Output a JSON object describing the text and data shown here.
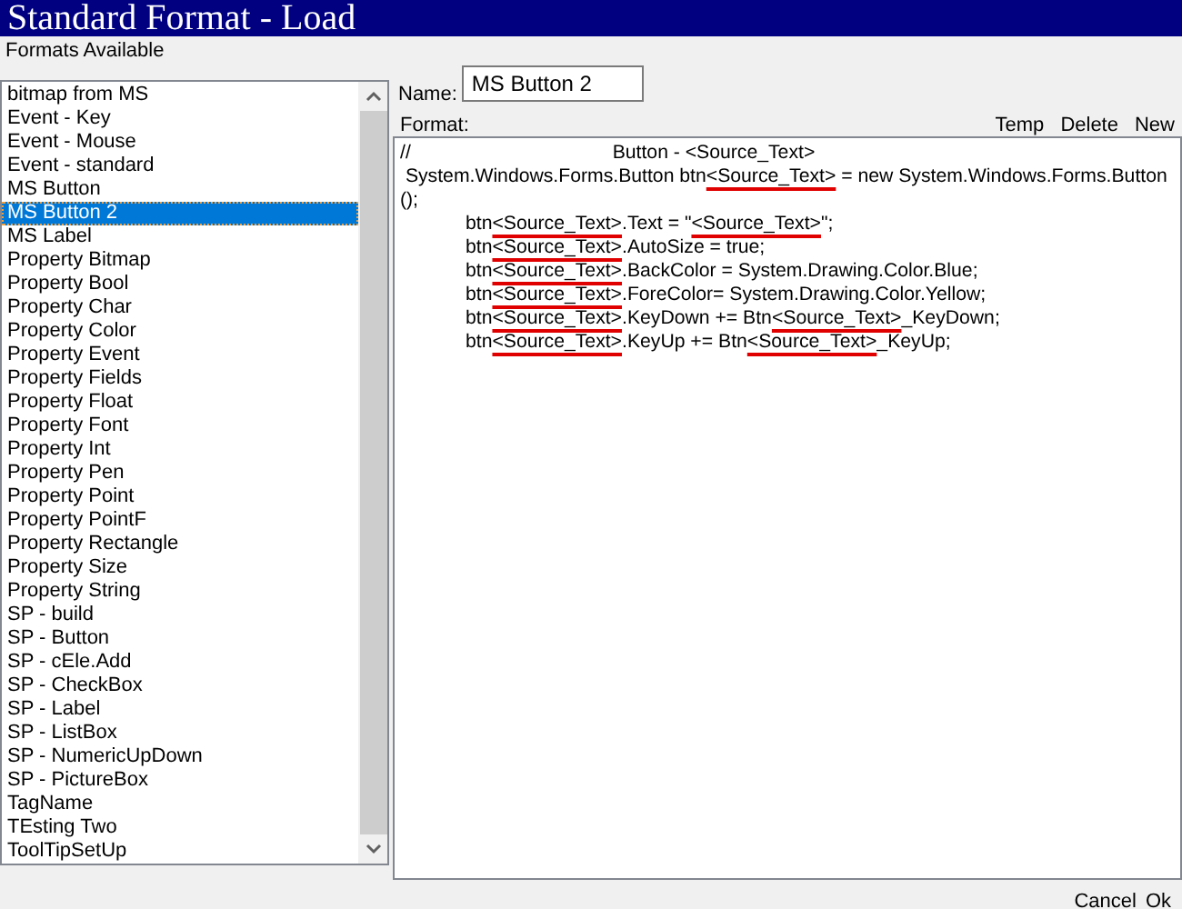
{
  "window": {
    "title": "Standard Format - Load"
  },
  "formats_label": "Formats Available",
  "formats": [
    {
      "label": "bitmap from MS",
      "selected": false
    },
    {
      "label": "Event - Key",
      "selected": false
    },
    {
      "label": "Event - Mouse",
      "selected": false
    },
    {
      "label": "Event - standard",
      "selected": false
    },
    {
      "label": "MS Button",
      "selected": false
    },
    {
      "label": "MS Button 2",
      "selected": true
    },
    {
      "label": "MS Label",
      "selected": false
    },
    {
      "label": "Property Bitmap",
      "selected": false
    },
    {
      "label": "Property Bool",
      "selected": false
    },
    {
      "label": "Property Char",
      "selected": false
    },
    {
      "label": "Property Color",
      "selected": false
    },
    {
      "label": "Property Event",
      "selected": false
    },
    {
      "label": "Property Fields",
      "selected": false
    },
    {
      "label": "Property Float",
      "selected": false
    },
    {
      "label": "Property Font",
      "selected": false
    },
    {
      "label": "Property Int",
      "selected": false
    },
    {
      "label": "Property Pen",
      "selected": false
    },
    {
      "label": "Property Point",
      "selected": false
    },
    {
      "label": "Property PointF",
      "selected": false
    },
    {
      "label": "Property Rectangle",
      "selected": false
    },
    {
      "label": "Property Size",
      "selected": false
    },
    {
      "label": "Property String",
      "selected": false
    },
    {
      "label": "SP - build",
      "selected": false
    },
    {
      "label": "SP - Button",
      "selected": false
    },
    {
      "label": "SP - cEle.Add",
      "selected": false
    },
    {
      "label": "SP - CheckBox",
      "selected": false
    },
    {
      "label": "SP - Label",
      "selected": false
    },
    {
      "label": "SP - ListBox",
      "selected": false
    },
    {
      "label": "SP - NumericUpDown",
      "selected": false
    },
    {
      "label": "SP - PictureBox",
      "selected": false
    },
    {
      "label": "TagName",
      "selected": false
    },
    {
      "label": "TEsting Two",
      "selected": false
    },
    {
      "label": "ToolTipSetUp",
      "selected": false
    }
  ],
  "name_field": {
    "label": "Name:",
    "value": "MS Button 2"
  },
  "format_label": "Format:",
  "format_actions": [
    "Temp",
    "Delete",
    "New"
  ],
  "format_lines": [
    {
      "segments": [
        {
          "text": "//\t\t\t   Button - <Source_Text>",
          "marked": false
        }
      ]
    },
    {
      "segments": [
        {
          "text": " System.Windows.Forms.Button btn",
          "marked": false
        },
        {
          "text": "<Source_Text>",
          "marked": true
        },
        {
          "text": " = new System.Windows.Forms.Button",
          "marked": false
        }
      ]
    },
    {
      "segments": [
        {
          "text": "();",
          "marked": false
        }
      ]
    },
    {
      "segments": [
        {
          "text": "\tbtn",
          "marked": false
        },
        {
          "text": "<Source_Text>",
          "marked": true
        },
        {
          "text": ".Text = \"",
          "marked": false
        },
        {
          "text": "<Source_Text>",
          "marked": true
        },
        {
          "text": "\";",
          "marked": false
        }
      ]
    },
    {
      "segments": [
        {
          "text": "\tbtn",
          "marked": false
        },
        {
          "text": "<Source_Text>",
          "marked": true
        },
        {
          "text": ".AutoSize = true;",
          "marked": false
        }
      ]
    },
    {
      "segments": [
        {
          "text": "\tbtn",
          "marked": false
        },
        {
          "text": "<Source_Text>",
          "marked": true
        },
        {
          "text": ".BackColor = System.Drawing.Color.Blue;",
          "marked": false
        }
      ]
    },
    {
      "segments": [
        {
          "text": "\tbtn",
          "marked": false
        },
        {
          "text": "<Source_Text>",
          "marked": true
        },
        {
          "text": ".ForeColor= System.Drawing.Color.Yellow;",
          "marked": false
        }
      ]
    },
    {
      "segments": [
        {
          "text": "\tbtn",
          "marked": false
        },
        {
          "text": "<Source_Text>",
          "marked": true
        },
        {
          "text": ".KeyDown += Btn",
          "marked": false
        },
        {
          "text": "<Source_Text>",
          "marked": true
        },
        {
          "text": "_KeyDown;",
          "marked": false
        }
      ]
    },
    {
      "segments": [
        {
          "text": "\tbtn",
          "marked": false
        },
        {
          "text": "<Source_Text>",
          "marked": true
        },
        {
          "text": ".KeyUp += Btn",
          "marked": false
        },
        {
          "text": "<Source_Text>",
          "marked": true
        },
        {
          "text": "_KeyUp;",
          "marked": false
        }
      ]
    }
  ],
  "dialog_buttons": [
    "Cancel",
    "Ok"
  ]
}
